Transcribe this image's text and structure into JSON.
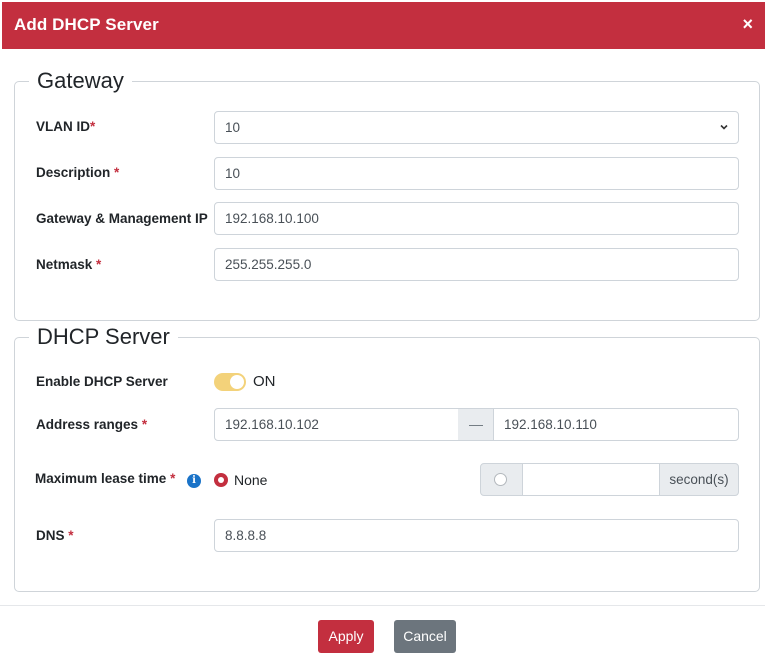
{
  "dialog": {
    "title": "Add DHCP Server",
    "close_symbol": "×"
  },
  "gateway": {
    "legend": "Gateway",
    "vlan_id": {
      "label": "VLAN ID",
      "required_mark": "*",
      "value": "10"
    },
    "description": {
      "label": "Description",
      "required_mark": "*",
      "value": "10"
    },
    "gateway_ip": {
      "label": "Gateway & Management IP",
      "value": "192.168.10.100"
    },
    "netmask": {
      "label": "Netmask",
      "required_mark": "*",
      "value": "255.255.255.0"
    }
  },
  "dhcp": {
    "legend": "DHCP Server",
    "enable": {
      "label": "Enable DHCP Server",
      "state_text": "ON",
      "on": true
    },
    "address_ranges": {
      "label": "Address ranges",
      "required_mark": "*",
      "start": "192.168.10.102",
      "separator": "—",
      "end": "192.168.10.110"
    },
    "lease": {
      "label": "Maximum lease time",
      "required_mark": "*",
      "info_symbol": "i",
      "none_label": "None",
      "custom_value": "",
      "unit": "second(s)",
      "selected": "none"
    },
    "dns": {
      "label": "DNS",
      "required_mark": "*",
      "value": "8.8.8.8"
    }
  },
  "footer": {
    "apply_label": "Apply",
    "cancel_label": "Cancel"
  },
  "colors": {
    "accent": "#c32f3f",
    "toggle_on": "#f3d27a",
    "secondary": "#6c757d",
    "info": "#1a73c8"
  }
}
